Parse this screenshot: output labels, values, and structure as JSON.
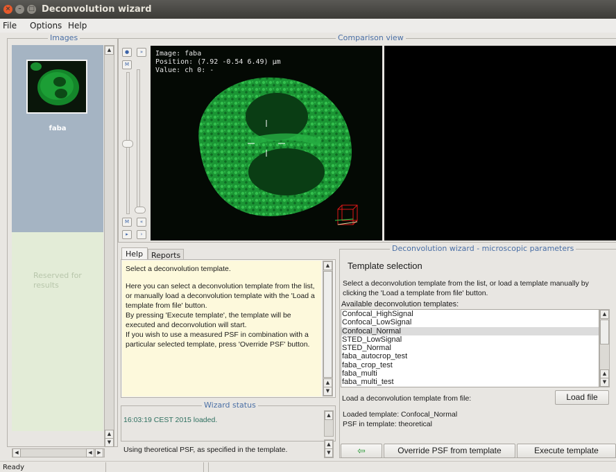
{
  "window": {
    "title": "Deconvolution wizard"
  },
  "menu": {
    "file": "File",
    "options": "Options",
    "help": "Help"
  },
  "images_panel": {
    "title": "Images",
    "thumb_label": "faba",
    "results_label": "Reserved for results"
  },
  "comparison": {
    "title": "Comparison view",
    "info_image": "Image: faba",
    "info_position": "Position: (7.92 -0.54 6.49) µm",
    "info_value": "Value: ch 0: -"
  },
  "help_panel": {
    "tab_help": "Help",
    "tab_reports": "Reports",
    "text": [
      "Select a deconvolution template.",
      "Here you can select a deconvolution template from the list, or manually load a deconvolution template with the 'Load a template from file' button.",
      "By pressing 'Execute template', the template will be executed and deconvolution will start.",
      "If you wish to use a measured PSF in combination with a particular selected template, press 'Override PSF' button."
    ]
  },
  "wizard_status": {
    "title": "Wizard status",
    "line1": "16:03:19 CEST 2015 loaded.",
    "line2": "Using theoretical PSF, as specified in the template."
  },
  "params": {
    "title": "Deconvolution wizard - microscopic parameters",
    "heading": "Template selection",
    "description": "Select a deconvolution template from the list, or load a template manually by clicking the 'Load a template from file' button.",
    "available_label": "Available deconvolution templates:",
    "templates": [
      "Confocal_HighSignal",
      "Confocal_LowSignal",
      "Confocal_Normal",
      "STED_LowSignal",
      "STED_Normal",
      "faba_autocrop_test",
      "faba_crop_test",
      "faba_multi",
      "faba_multi_test"
    ],
    "selected_template": "Confocal_Normal",
    "load_label": "Load a deconvolution template from file:",
    "load_button": "Load file",
    "loaded_template": "Loaded template: Confocal_Normal",
    "psf_in_template": "PSF in template: theoretical",
    "back_button": "⇦",
    "override_button": "Override PSF from template",
    "execute_button": "Execute template"
  },
  "statusbar": {
    "text": "Ready"
  },
  "colors": {
    "accent_title": "#4a6fa5",
    "image_green": "#1fa83a",
    "help_bg": "#fdf9dc",
    "status_green": "#2d6f5f"
  },
  "icons": [
    "close-icon",
    "minimize-icon",
    "maximize-icon",
    "zoom-in-icon",
    "fast-forward-icon",
    "first-frame-icon",
    "last-frame-icon",
    "rewind-icon",
    "play-icon",
    "forward-icon",
    "back-arrow-icon"
  ]
}
